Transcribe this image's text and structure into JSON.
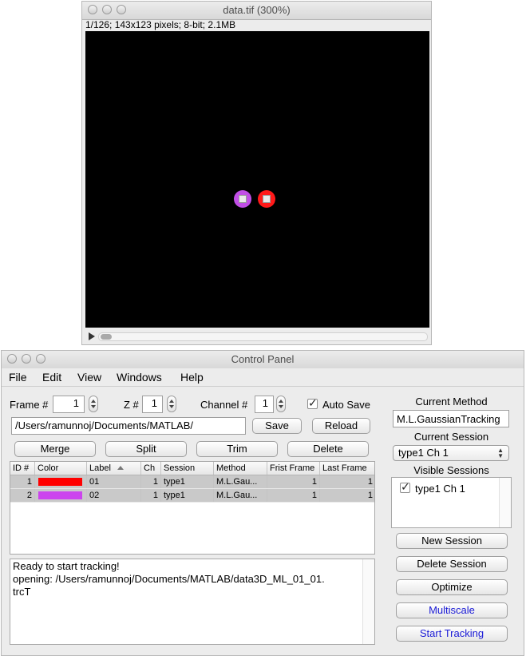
{
  "image_window": {
    "title": "data.tif (300%)",
    "info": "1/126; 143x123 pixels; 8-bit; 2.1MB",
    "spots": [
      {
        "ring_color": "#c14ee6"
      },
      {
        "ring_color": "#ff1a1a"
      }
    ]
  },
  "control_panel": {
    "title": "Control Panel",
    "menu": [
      "File",
      "Edit",
      "View",
      "Windows",
      "Help"
    ],
    "frame_label": "Frame #",
    "frame_value": "1",
    "z_label": "Z #",
    "z_value": "1",
    "channel_label": "Channel #",
    "channel_value": "1",
    "auto_save_label": "Auto Save",
    "path": "/Users/ramunnoj/Documents/MATLAB/",
    "save_label": "Save",
    "reload_label": "Reload",
    "merge_label": "Merge",
    "split_label": "Split",
    "trim_label": "Trim",
    "delete_label": "Delete",
    "table": {
      "headers": [
        "ID #",
        "Color",
        "Label",
        "Ch",
        "Session",
        "Method",
        "Frist Frame",
        "Last Frame"
      ],
      "rows": [
        {
          "id": "1",
          "color": "#ff0000",
          "label": "01",
          "ch": "1",
          "session": "type1",
          "method": "M.L.Gau...",
          "first": "1",
          "last": "1"
        },
        {
          "id": "2",
          "color": "#cc44ee",
          "label": "02",
          "ch": "1",
          "session": "type1",
          "method": "M.L.Gau...",
          "first": "1",
          "last": "1"
        }
      ]
    },
    "log_lines": [
      "Ready to start tracking!",
      "opening: /Users/ramunnoj/Documents/MATLAB/data3D_ML_01_01.",
      "trcT"
    ],
    "current_method_label": "Current Method",
    "current_method_value": "M.L.GaussianTracking",
    "current_session_label": "Current Session",
    "current_session_value": "type1 Ch 1",
    "visible_sessions_label": "Visible Sessions",
    "visible_sessions": [
      "type1 Ch 1"
    ],
    "new_session_label": "New Session",
    "delete_session_label": "Delete Session",
    "optimize_label": "Optimize",
    "multiscale_label": "Multiscale",
    "start_tracking_label": "Start Tracking"
  }
}
